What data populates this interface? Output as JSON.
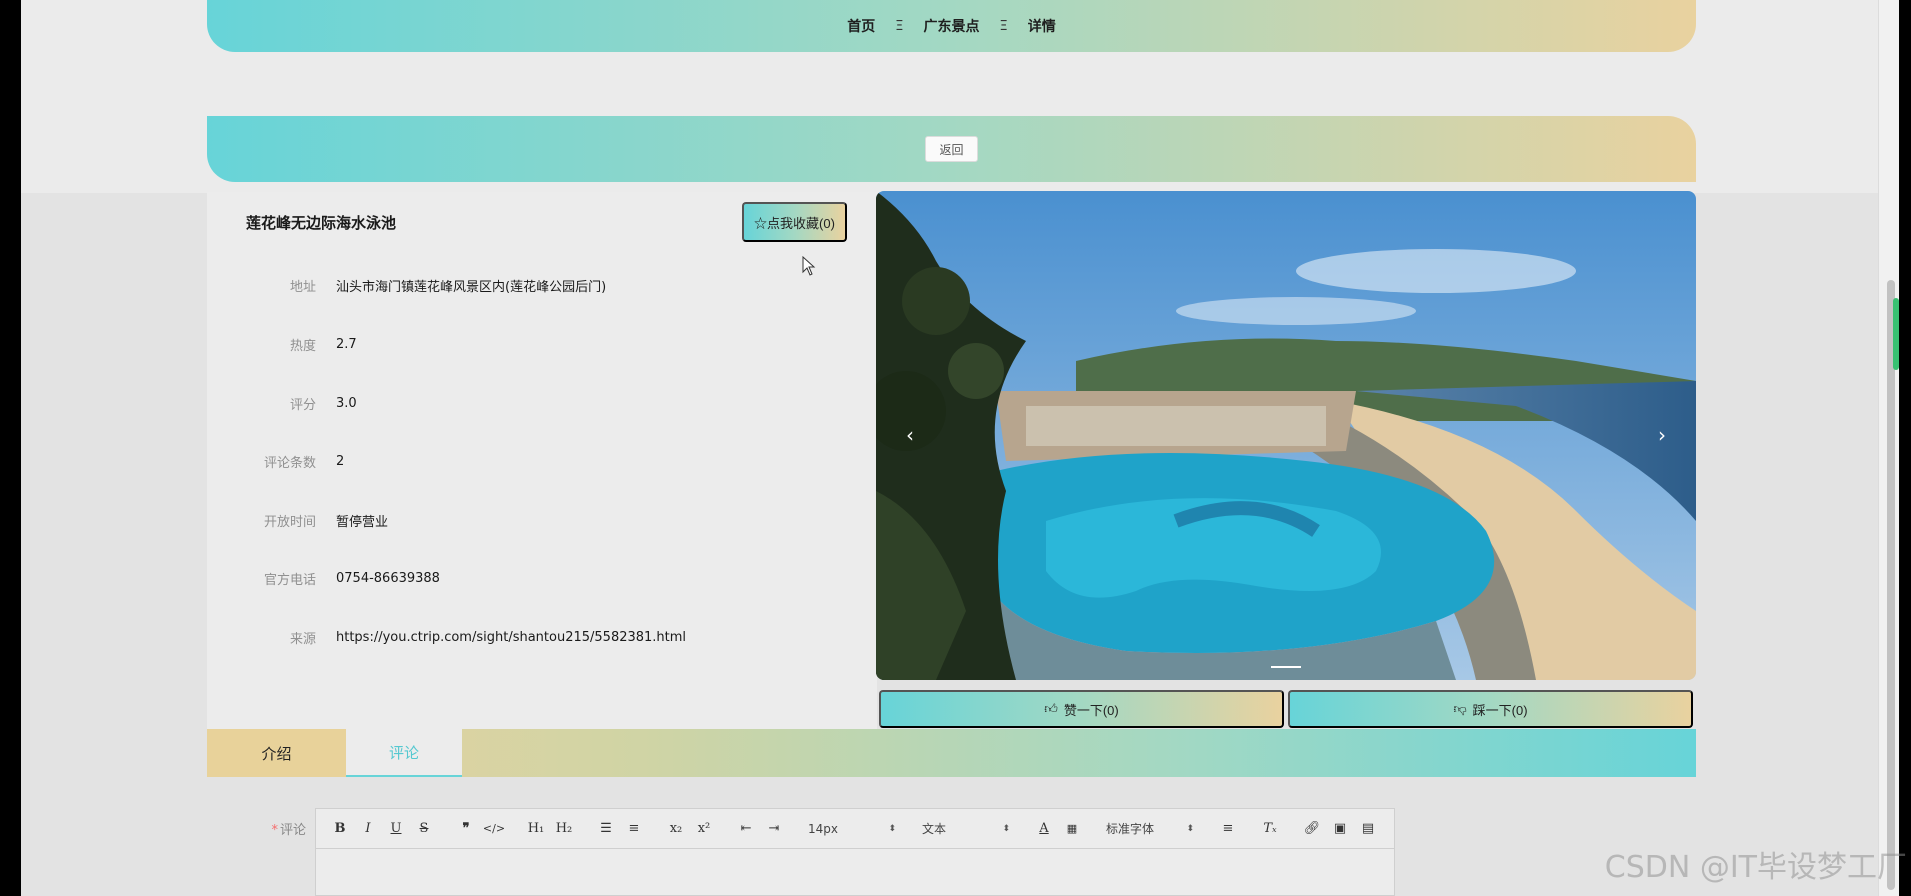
{
  "breadcrumb": {
    "items": [
      "首页",
      "广东景点",
      "详情"
    ],
    "separator": "Ξ"
  },
  "back_label": "返回",
  "detail": {
    "title": "莲花峰无边际海水泳池",
    "favorite_label": "☆点我收藏(0)",
    "fields": [
      {
        "label": "地址",
        "value": "汕头市海门镇莲花峰风景区内(莲花峰公园后门)"
      },
      {
        "label": "热度",
        "value": "2.7"
      },
      {
        "label": "评分",
        "value": "3.0"
      },
      {
        "label": "评论条数",
        "value": "2"
      },
      {
        "label": "开放时间",
        "value": "暂停营业"
      },
      {
        "label": "官方电话",
        "value": "0754-86639388"
      },
      {
        "label": "来源",
        "value": "https://you.ctrip.com/sight/shantou215/5582381.html"
      }
    ]
  },
  "carousel": {
    "prev": "‹",
    "next": "›"
  },
  "votes": {
    "like_label": "赞一下(0)",
    "dislike_label": "踩一下(0)"
  },
  "tabs": {
    "intro": "介绍",
    "comment": "评论"
  },
  "comment_form": {
    "required_mark": "*",
    "label": "评论",
    "size_option": "14px",
    "text_option": "文本",
    "font_option": "标准字体"
  },
  "watermark": "CSDN @IT毕设梦工厂",
  "colors": {
    "gradient_start": "#67d4d8",
    "gradient_end": "#e9d29f",
    "active_tab": "#55c8d0"
  }
}
